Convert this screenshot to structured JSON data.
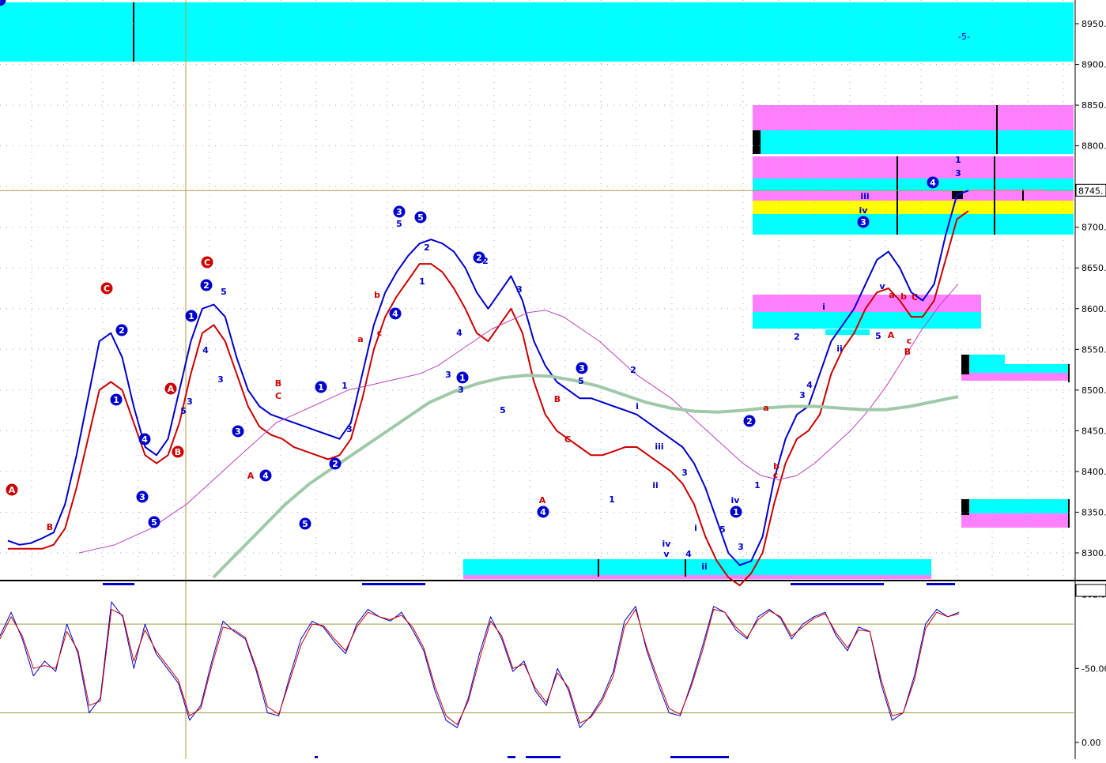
{
  "chart_data": {
    "type": "line",
    "panels": [
      {
        "name": "price",
        "yticks": [
          8300,
          8350,
          8400,
          8450,
          8500,
          8550,
          8600,
          8650,
          8700,
          8750,
          8800,
          8850,
          8900,
          8950
        ],
        "ytick_labels": [
          "8300.",
          "8350.",
          "8400.",
          "8450.",
          "8500.",
          "8550.",
          "8600.",
          "8650.",
          "8700.",
          "",
          "8800.",
          "8850.",
          "8900.",
          "8950."
        ],
        "ylim": [
          8265,
          8975
        ],
        "current_price_label": "8745.",
        "current_price": 8745,
        "top_marker_text": "-5-",
        "series": [
          {
            "kind": "blue-band",
            "color": "#0000cc",
            "values": [
              8315,
              8310,
              8312,
              8318,
              8325,
              8360,
              8420,
              8490,
              8560,
              8570,
              8540,
              8480,
              8430,
              8420,
              8440,
              8500,
              8560,
              8600,
              8605,
              8590,
              8540,
              8500,
              8480,
              8470,
              8465,
              8460,
              8455,
              8450,
              8445,
              8440,
              8460,
              8520,
              8580,
              8620,
              8645,
              8665,
              8680,
              8685,
              8680,
              8670,
              8650,
              8620,
              8600,
              8620,
              8640,
              8610,
              8560,
              8530,
              8510,
              8500,
              8490,
              8490,
              8485,
              8480,
              8475,
              8470,
              8460,
              8450,
              8440,
              8430,
              8410,
              8380,
              8340,
              8300,
              8285,
              8290,
              8320,
              8390,
              8440,
              8470,
              8480,
              8520,
              8560,
              8580,
              8600,
              8630,
              8660,
              8670,
              8650,
              8620,
              8610,
              8630,
              8690,
              8740,
              8745
            ]
          },
          {
            "kind": "red-band",
            "color": "#cc0000",
            "values": [
              8305,
              8305,
              8305,
              8305,
              8310,
              8330,
              8380,
              8440,
              8500,
              8510,
              8500,
              8460,
              8420,
              8410,
              8420,
              8460,
              8520,
              8570,
              8580,
              8560,
              8520,
              8480,
              8455,
              8445,
              8440,
              8430,
              8425,
              8420,
              8415,
              8420,
              8440,
              8490,
              8550,
              8590,
              8615,
              8635,
              8655,
              8655,
              8645,
              8625,
              8600,
              8570,
              8560,
              8580,
              8600,
              8570,
              8510,
              8470,
              8450,
              8440,
              8430,
              8420,
              8420,
              8425,
              8430,
              8430,
              8420,
              8410,
              8400,
              8385,
              8360,
              8320,
              8290,
              8270,
              8260,
              8275,
              8300,
              8360,
              8410,
              8440,
              8450,
              8470,
              8520,
              8550,
              8570,
              8600,
              8620,
              8625,
              8610,
              8590,
              8590,
              8610,
              8660,
              8710,
              8720
            ]
          },
          {
            "kind": "magenta-ma",
            "color": "#c040c0",
            "values": [
              8300,
              8305,
              8310,
              8320,
              8330,
              8345,
              8360,
              8380,
              8400,
              8420,
              8440,
              8460,
              8470,
              8480,
              8490,
              8500,
              8505,
              8510,
              8515,
              8520,
              8530,
              8545,
              8560,
              8575,
              8585,
              8595,
              8598,
              8590,
              8575,
              8560,
              8540,
              8520,
              8505,
              8490,
              8470,
              8450,
              8430,
              8410,
              8395,
              8390,
              8395,
              8410,
              8430,
              8450,
              8475,
              8505,
              8540,
              8575,
              8605,
              8630
            ]
          },
          {
            "kind": "green-ma",
            "color": "#9fc9a8",
            "values": [
              8270,
              8300,
              8330,
              8360,
              8385,
              8405,
              8425,
              8445,
              8465,
              8485,
              8498,
              8508,
              8515,
              8518,
              8517,
              8512,
              8505,
              8495,
              8485,
              8478,
              8474,
              8473,
              8475,
              8478,
              8480,
              8480,
              8478,
              8476,
              8476,
              8480,
              8486,
              8492
            ]
          }
        ]
      },
      {
        "name": "stochastic",
        "yticks": [
          0,
          50,
          100
        ],
        "ytick_labels": [
          "0.00",
          "-50.00",
          "102.5"
        ],
        "ylim": [
          0,
          105
        ],
        "reference_levels": [
          20,
          80
        ],
        "series": [
          {
            "kind": "fast",
            "color": "#0000cc",
            "values": [
              72,
              88,
              70,
              45,
              55,
              48,
              80,
              60,
              20,
              30,
              95,
              85,
              50,
              80,
              60,
              50,
              40,
              15,
              25,
              55,
              82,
              75,
              70,
              48,
              20,
              18,
              45,
              70,
              82,
              78,
              68,
              60,
              80,
              90,
              85,
              82,
              88,
              76,
              62,
              35,
              15,
              10,
              30,
              60,
              85,
              70,
              48,
              55,
              35,
              25,
              50,
              35,
              10,
              18,
              30,
              48,
              82,
              92,
              62,
              40,
              20,
              18,
              40,
              65,
              92,
              88,
              76,
              70,
              85,
              90,
              84,
              70,
              80,
              85,
              88,
              72,
              62,
              78,
              75,
              40,
              15,
              20,
              45,
              80,
              90,
              85,
              88
            ]
          },
          {
            "kind": "slow",
            "color": "#cc0000",
            "values": [
              70,
              85,
              72,
              50,
              52,
              50,
              75,
              62,
              25,
              28,
              90,
              86,
              55,
              76,
              62,
              52,
              42,
              18,
              23,
              52,
              78,
              76,
              71,
              50,
              24,
              19,
              42,
              66,
              80,
              79,
              70,
              62,
              78,
              88,
              85,
              83,
              86,
              78,
              64,
              38,
              18,
              12,
              28,
              56,
              82,
              72,
              50,
              53,
              37,
              27,
              47,
              37,
              13,
              17,
              28,
              45,
              78,
              90,
              64,
              43,
              23,
              19,
              38,
              62,
              90,
              88,
              78,
              71,
              83,
              89,
              85,
              72,
              78,
              84,
              87,
              74,
              64,
              76,
              75,
              43,
              18,
              20,
              42,
              77,
              88,
              85,
              87
            ]
          }
        ]
      }
    ],
    "wave_labels": [
      {
        "text": "A",
        "color": "red",
        "circled": true
      },
      {
        "text": "B",
        "color": "red",
        "circled": false
      },
      {
        "text": "C",
        "color": "red",
        "circled": true
      },
      {
        "text": "2",
        "color": "blue",
        "circled": true
      },
      {
        "text": "1",
        "color": "blue",
        "circled": true
      },
      {
        "text": "4",
        "color": "blue",
        "circled": true
      },
      {
        "text": "3",
        "color": "blue",
        "circled": true
      },
      {
        "text": "5",
        "color": "blue",
        "circled": true
      },
      {
        "text": "B",
        "color": "red",
        "circled": true
      },
      {
        "text": "A",
        "color": "red",
        "circled": true
      },
      {
        "text": "C",
        "color": "red",
        "circled": true
      },
      {
        "text": "5",
        "color": "blue",
        "circled": false
      },
      {
        "text": "3",
        "color": "blue",
        "circled": false
      },
      {
        "text": "2",
        "color": "blue",
        "circled": true
      },
      {
        "text": "1",
        "color": "blue",
        "circled": true
      },
      {
        "text": "4",
        "color": "blue",
        "circled": false
      },
      {
        "text": "3",
        "color": "blue",
        "circled": false
      },
      {
        "text": "5",
        "color": "blue",
        "circled": false
      },
      {
        "text": "3",
        "color": "blue",
        "circled": true
      },
      {
        "text": "A",
        "color": "red",
        "circled": false
      },
      {
        "text": "B",
        "color": "red",
        "circled": false
      },
      {
        "text": "C",
        "color": "red",
        "circled": false
      },
      {
        "text": "4",
        "color": "blue",
        "circled": true
      },
      {
        "text": "5",
        "color": "blue",
        "circled": true
      },
      {
        "text": "1",
        "color": "blue",
        "circled": true
      },
      {
        "text": "2",
        "color": "blue",
        "circled": true
      },
      {
        "text": "1",
        "color": "blue",
        "circled": false
      },
      {
        "text": "3",
        "color": "blue",
        "circled": false
      },
      {
        "text": "a",
        "color": "red",
        "circled": false
      },
      {
        "text": "b",
        "color": "red",
        "circled": false
      },
      {
        "text": "c",
        "color": "red",
        "circled": false
      },
      {
        "text": "4",
        "color": "blue",
        "circled": true
      },
      {
        "text": "3",
        "color": "blue",
        "circled": true
      },
      {
        "text": "5",
        "color": "blue",
        "circled": true
      },
      {
        "text": "5",
        "color": "blue",
        "circled": false
      },
      {
        "text": "2",
        "color": "blue",
        "circled": false
      },
      {
        "text": "1",
        "color": "blue",
        "circled": false
      },
      {
        "text": "2",
        "color": "blue",
        "circled": true
      },
      {
        "text": "2",
        "color": "blue",
        "circled": false
      },
      {
        "text": "4",
        "color": "blue",
        "circled": false
      },
      {
        "text": "3",
        "color": "blue",
        "circled": false
      },
      {
        "text": "1",
        "color": "blue",
        "circled": true
      },
      {
        "text": "3",
        "color": "blue",
        "circled": false
      },
      {
        "text": "5",
        "color": "blue",
        "circled": false
      },
      {
        "text": "3",
        "color": "blue",
        "circled": false
      },
      {
        "text": "4",
        "color": "blue",
        "circled": true
      },
      {
        "text": "A",
        "color": "red",
        "circled": false
      },
      {
        "text": "B",
        "color": "red",
        "circled": false
      },
      {
        "text": "C",
        "color": "red",
        "circled": false
      },
      {
        "text": "5",
        "color": "blue",
        "circled": false
      },
      {
        "text": "3",
        "color": "blue",
        "circled": true
      },
      {
        "text": "1",
        "color": "blue",
        "circled": false
      },
      {
        "text": "2",
        "color": "blue",
        "circled": false
      },
      {
        "text": "i",
        "color": "blue",
        "circled": false
      },
      {
        "text": "ii",
        "color": "blue",
        "circled": false
      },
      {
        "text": "iii",
        "color": "blue",
        "circled": false
      },
      {
        "text": "iv",
        "color": "blue",
        "circled": false
      },
      {
        "text": "v",
        "color": "blue",
        "circled": false
      },
      {
        "text": "3",
        "color": "blue",
        "circled": false
      },
      {
        "text": "4",
        "color": "blue",
        "circled": false
      },
      {
        "text": "i",
        "color": "blue",
        "circled": false
      },
      {
        "text": "ii",
        "color": "blue",
        "circled": false
      },
      {
        "text": "iv",
        "color": "blue",
        "circled": false
      },
      {
        "text": "1",
        "color": "blue",
        "circled": true
      },
      {
        "text": "5",
        "color": "blue",
        "circled": false
      },
      {
        "text": "3",
        "color": "blue",
        "circled": false
      },
      {
        "text": "2",
        "color": "blue",
        "circled": true
      },
      {
        "text": "1",
        "color": "blue",
        "circled": false
      },
      {
        "text": "a",
        "color": "red",
        "circled": false
      },
      {
        "text": "b",
        "color": "red",
        "circled": false
      },
      {
        "text": "c",
        "color": "red",
        "circled": false
      },
      {
        "text": "2",
        "color": "blue",
        "circled": false
      },
      {
        "text": "3",
        "color": "blue",
        "circled": false
      },
      {
        "text": "4",
        "color": "blue",
        "circled": false
      },
      {
        "text": "i",
        "color": "blue",
        "circled": false
      },
      {
        "text": "ii",
        "color": "blue",
        "circled": false
      },
      {
        "text": "iii",
        "color": "blue",
        "circled": false
      },
      {
        "text": "iv",
        "color": "blue",
        "circled": false
      },
      {
        "text": "3",
        "color": "blue",
        "circled": true
      },
      {
        "text": "5",
        "color": "blue",
        "circled": false
      },
      {
        "text": "v",
        "color": "blue",
        "circled": false
      },
      {
        "text": "A",
        "color": "red",
        "circled": false
      },
      {
        "text": "a",
        "color": "red",
        "circled": false
      },
      {
        "text": "b",
        "color": "red",
        "circled": false
      },
      {
        "text": "c",
        "color": "red",
        "circled": false
      },
      {
        "text": "B",
        "color": "red",
        "circled": false
      },
      {
        "text": "C",
        "color": "red",
        "circled": false
      },
      {
        "text": "4",
        "color": "blue",
        "circled": true
      },
      {
        "text": "1",
        "color": "blue",
        "circled": false
      },
      {
        "text": "3",
        "color": "blue",
        "circled": false
      },
      {
        "text": "5",
        "color": "blue",
        "circled": true
      },
      {
        "text": "5",
        "color": "blue",
        "circled": false
      }
    ],
    "zone_colors": {
      "cyan": "#00ffff",
      "magenta": "#ff80ff",
      "yellow": "#ffff00"
    },
    "grid": true,
    "legend": "none"
  }
}
